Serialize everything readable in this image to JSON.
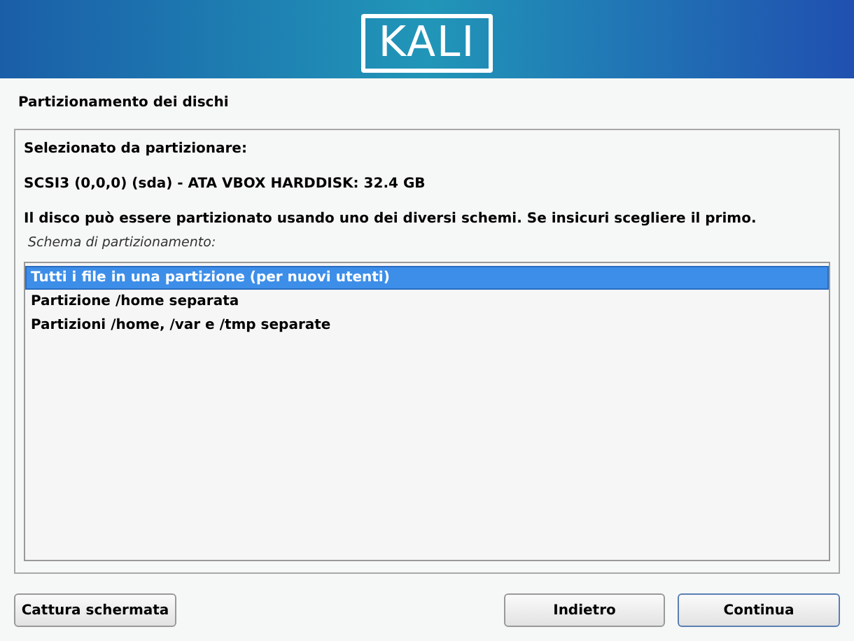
{
  "banner": {
    "logo": "KALI"
  },
  "title": "Partizionamento dei dischi",
  "selected_label": "Selezionato da partizionare:",
  "disk": "SCSI3 (0,0,0) (sda) - ATA VBOX HARDDISK: 32.4 GB",
  "description": "Il disco può essere partizionato usando uno dei diversi schemi. Se insicuri scegliere il primo.",
  "list_label": "Schema di partizionamento:",
  "options": [
    {
      "label": "Tutti i file in una partizione (per nuovi utenti)",
      "selected": true
    },
    {
      "label": "Partizione /home separata",
      "selected": false
    },
    {
      "label": "Partizioni /home, /var e /tmp separate",
      "selected": false
    }
  ],
  "buttons": {
    "screenshot": "Cattura schermata",
    "back": "Indietro",
    "continue": "Continua"
  }
}
